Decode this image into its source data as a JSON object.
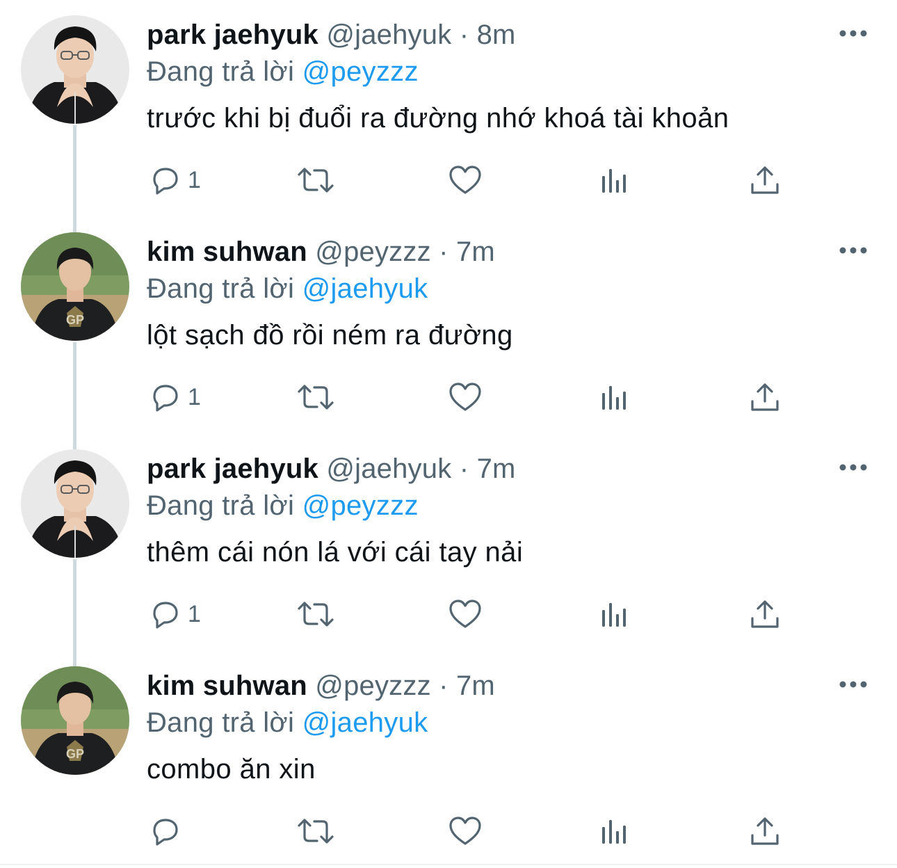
{
  "tweets": [
    {
      "display_name": "park jaehyuk",
      "handle": "@jaehyuk",
      "separator": "·",
      "time": "8m",
      "reply_prefix": "Đang trả lời",
      "reply_to": "@peyzzz",
      "text": "trước khi bị đuổi ra đường nhớ khoá tài khoản",
      "reply_count": "1",
      "avatar": "park-jaehyuk-avatar"
    },
    {
      "display_name": "kim suhwan",
      "handle": "@peyzzz",
      "separator": "·",
      "time": "7m",
      "reply_prefix": "Đang trả lời",
      "reply_to": "@jaehyuk",
      "text": "lột sạch đồ rồi ném ra đường",
      "reply_count": "1",
      "avatar": "kim-suhwan-avatar"
    },
    {
      "display_name": "park jaehyuk",
      "handle": "@jaehyuk",
      "separator": "·",
      "time": "7m",
      "reply_prefix": "Đang trả lời",
      "reply_to": "@peyzzz",
      "text": "thêm cái nón lá với cái tay nải",
      "reply_count": "1",
      "avatar": "park-jaehyuk-avatar"
    },
    {
      "display_name": "kim suhwan",
      "handle": "@peyzzz",
      "separator": "·",
      "time": "7m",
      "reply_prefix": "Đang trả lời",
      "reply_to": "@jaehyuk",
      "text": "combo ăn xin",
      "reply_count": "",
      "avatar": "kim-suhwan-avatar"
    }
  ],
  "colors": {
    "text_primary": "#0f1419",
    "text_secondary": "#536471",
    "mention": "#1d9bf0",
    "thread_line": "#cfd9de"
  },
  "icons": [
    "reply-icon",
    "retweet-icon",
    "like-icon",
    "views-icon",
    "share-icon",
    "more-icon"
  ]
}
